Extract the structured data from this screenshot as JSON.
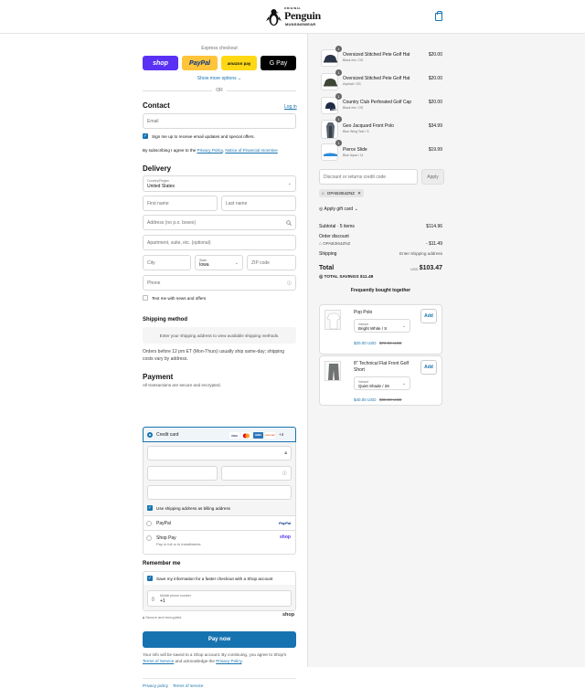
{
  "header": {
    "logo_top": "ORIGINAL",
    "logo_main": "Penguin",
    "logo_sub": "MUNSINGWEAR"
  },
  "express": {
    "label": "Express checkout",
    "buttons": [
      {
        "label": "shop",
        "bg": "#5a31f4",
        "fg": "#ffffff"
      },
      {
        "label": "PayPal",
        "bg": "#ffc439",
        "fg": "#003087"
      },
      {
        "label": "amazon pay",
        "bg": "#ffd814",
        "fg": "#111111"
      },
      {
        "label": "G Pay",
        "bg": "#000000",
        "fg": "#ffffff"
      }
    ],
    "more": "Show more options",
    "or": "OR"
  },
  "contact": {
    "title": "Contact",
    "login": "Log in",
    "email_placeholder": "Email",
    "news_label": "Sign me up to receive email updates and special offers.",
    "terms_prefix": "By subscribing I agree to the ",
    "privacy": "Privacy Policy",
    ",": ", ",
    "notice": "Notice of Financial Incentive"
  },
  "delivery": {
    "title": "Delivery",
    "country_label": "Country/Region",
    "country": "United States",
    "first": "First name",
    "last": "Last name",
    "address": "Address (no p.o. boxes)",
    "apt": "Apartment, suite, etc. (optional)",
    "city": "City",
    "state_label": "State",
    "state": "Iowa",
    "zip": "ZIP code",
    "phone": "Phone",
    "text_label": "Text me with news and offers"
  },
  "shipping": {
    "title": "Shipping method",
    "notice": "Enter your shipping address to view available shipping methods.",
    "note": "Orders before 12 pm ET (Mon-Thurs) usually ship same-day; shipping costs vary by address."
  },
  "payment": {
    "title": "Payment",
    "sub": "All transactions are secure and encrypted.",
    "credit": "Credit card",
    "cards": [
      "VISA",
      "MC",
      "AMEX",
      "DISCOVER"
    ],
    "more_cards": "+4",
    "billing": "Use shipping address as billing address",
    "paypal": "PayPal",
    "paypal_logo": "PayPal",
    "shoppay": "Shop Pay",
    "shoppay_sub": "Pay in full or in installments",
    "shop_logo": "shop"
  },
  "remember": {
    "title": "Remember me",
    "save": "Save my information for a faster checkout with a Shop account",
    "mobile_label": "Mobile phone number",
    "mobile_value": "+1",
    "secure": "Secure and encrypted",
    "shop": "shop"
  },
  "pay": {
    "label": "Pay now"
  },
  "legal": {
    "prefix": "Your info will be saved to a Shop account. By continuing, you agree to Shop's ",
    "terms": "Terms of Service",
    "mid": " and acknowledge the ",
    "privacy": "Privacy Policy",
    "end": "."
  },
  "footer": {
    "privacy": "Privacy policy",
    "terms": "Terms of service"
  },
  "cart": {
    "items": [
      {
        "qty": "1",
        "name": "Oversized Stitched Pete Golf Hat",
        "variant": "Black Iris / OS",
        "price": "$20.00",
        "color": "#2b3548"
      },
      {
        "qty": "1",
        "name": "Oversized Stitched Pete Golf Hat",
        "variant": "Asphalt / OS",
        "price": "$20.00",
        "color": "#3d4536"
      },
      {
        "qty": "1",
        "name": "Country Club Perforated Golf Cap",
        "variant": "Black Iris / OS",
        "price": "$20.00",
        "color": "#1f2a44"
      },
      {
        "qty": "1",
        "name": "Geo Jacquard Front Polo",
        "variant": "Blue Wing Teal / S",
        "price": "$34.99",
        "color": "#5a6470"
      },
      {
        "qty": "1",
        "name": "Pierce Slide",
        "variant": "Blue Aqua / 11",
        "price": "$19.99",
        "color": "#2e8bd6"
      }
    ],
    "discount_placeholder": "Discount or returns credit code",
    "apply": "Apply",
    "code": "OPAB3I64ZNZ",
    "gift": "Apply gift card",
    "subtotal_label": "Subtotal · 5 items",
    "subtotal": "$114.96",
    "order_discount": "Order discount",
    "discount_code": "OPAB3I64ZNZ",
    "discount_value": "- $11.49",
    "shipping_label": "Shipping",
    "shipping_value": "Enter shipping address",
    "total_label": "Total",
    "currency": "USD",
    "total": "$103.47",
    "savings_label": "TOTAL SAVINGS",
    "savings": "$11.49",
    "fbt_title": "Frequently bought together",
    "fbt": [
      {
        "name": "Pop Polo",
        "variant_label": "Variant",
        "variant": "Bright White / S",
        "price": "$20.00 USD",
        "old": "$79.00 USD",
        "add": "Add"
      },
      {
        "name": "8\" Technical Flat Front Golf Short",
        "variant_label": "Variant",
        "variant": "Quiet Shade / 28",
        "price": "$40.00 USD",
        "old": "$85.00 USD",
        "add": "Add"
      }
    ]
  }
}
